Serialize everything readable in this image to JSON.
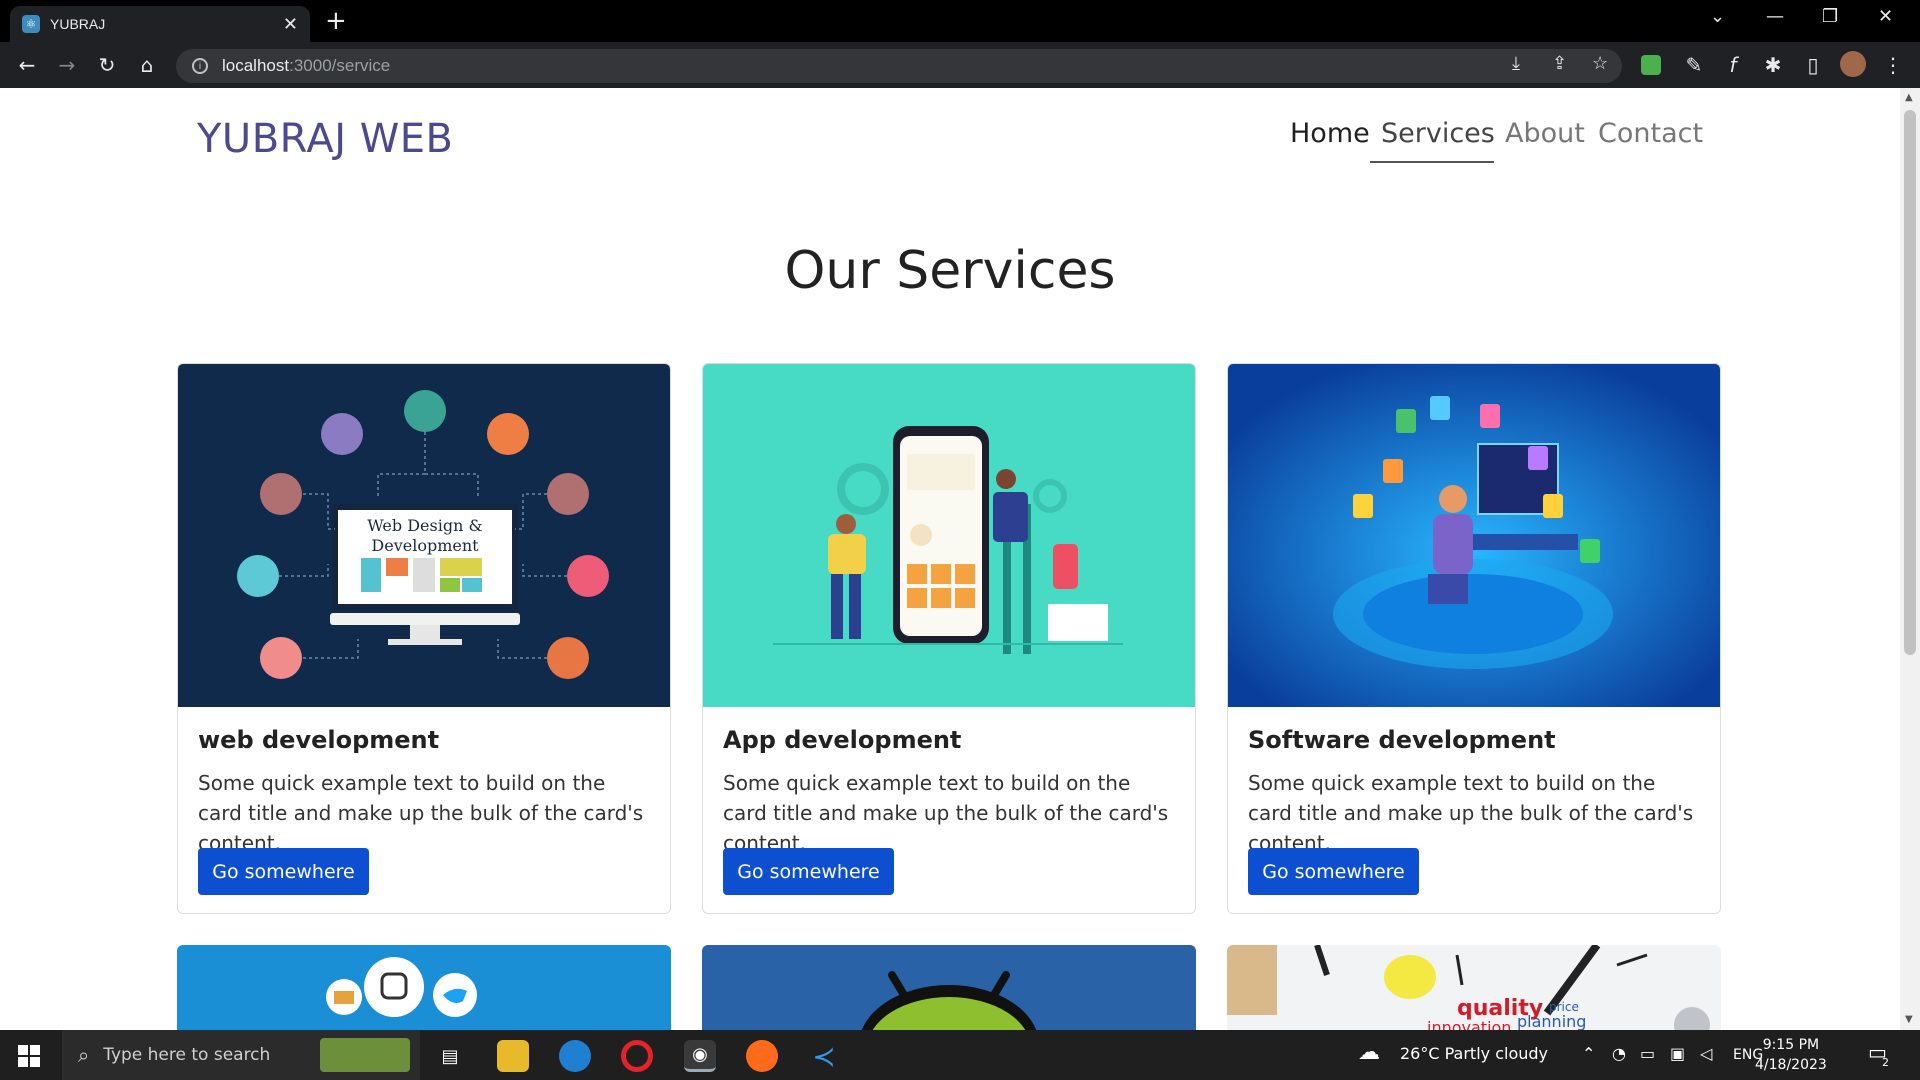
{
  "browser": {
    "tab_title": "YUBRAJ",
    "tab_close": "✕",
    "new_tab": "+",
    "url_host": "localhost",
    "url_path": ":3000/service"
  },
  "site": {
    "brand": "YUBRAJ WEB",
    "nav": [
      {
        "label": "Home"
      },
      {
        "label": "Services"
      },
      {
        "label": "About"
      },
      {
        "label": "Contact"
      }
    ]
  },
  "main": {
    "heading": "Our Services",
    "cards": [
      {
        "title": "web development",
        "text": "Some quick example text to build on the card title and make up the bulk of the card's content.",
        "button": "Go somewhere",
        "image_caption": "Web Design & Development",
        "image_bg": "#102a4c"
      },
      {
        "title": "App development",
        "text": "Some quick example text to build on the card title and make up the bulk of the card's content.",
        "button": "Go somewhere",
        "image_bg": "#47dac5"
      },
      {
        "title": "Software development",
        "text": "Some quick example text to build on the card title and make up the bulk of the card's content.",
        "button": "Go somewhere",
        "image_bg": "#0c4fb8"
      }
    ],
    "partial_cards": [
      {
        "image_bg": "#1a8fd6"
      },
      {
        "image_bg": "#2a62a8"
      },
      {
        "image_bg": "#f2f3f5",
        "word1": "quality",
        "word2": "innovation",
        "word3": "planning",
        "word4": "price"
      }
    ]
  },
  "taskbar": {
    "search_placeholder": "Type here to search",
    "weather": "26°C  Partly cloudy",
    "language": "ENG",
    "time": "9:15 PM",
    "date": "4/18/2023",
    "notification_count": "2"
  },
  "colors": {
    "brand": "#4b4a8c",
    "button": "#0d4fd1"
  }
}
